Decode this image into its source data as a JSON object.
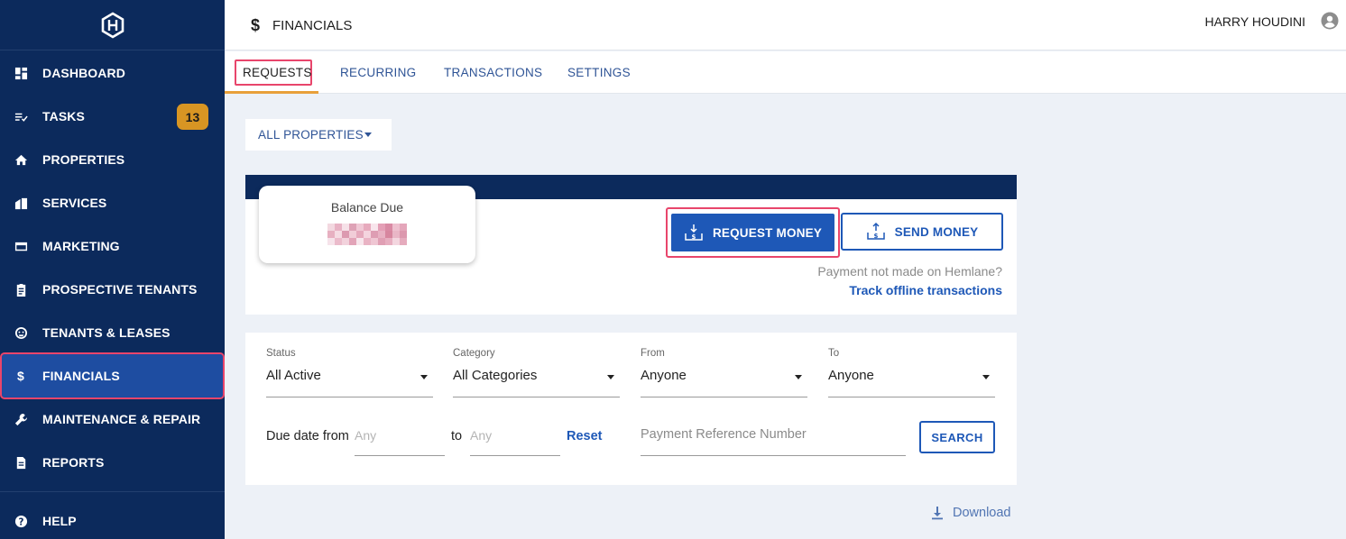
{
  "sidebar": {
    "items": [
      {
        "label": "DASHBOARD",
        "icon": "dashboard-icon"
      },
      {
        "label": "TASKS",
        "icon": "tasks-icon",
        "badge": "13"
      },
      {
        "label": "PROPERTIES",
        "icon": "home-icon"
      },
      {
        "label": "SERVICES",
        "icon": "services-icon"
      },
      {
        "label": "MARKETING",
        "icon": "marketing-icon"
      },
      {
        "label": "PROSPECTIVE TENANTS",
        "icon": "clipboard-icon"
      },
      {
        "label": "TENANTS & LEASES",
        "icon": "tenants-icon"
      },
      {
        "label": "FINANCIALS",
        "icon": "dollar-icon",
        "active": true
      },
      {
        "label": "MAINTENANCE & REPAIR",
        "icon": "wrench-icon"
      },
      {
        "label": "REPORTS",
        "icon": "document-icon"
      },
      {
        "label": "HELP",
        "icon": "help-icon"
      }
    ]
  },
  "header": {
    "section_icon": "$",
    "title": "FINANCIALS",
    "user_name": "HARRY HOUDINI"
  },
  "tabs": [
    {
      "label": "REQUESTS",
      "active": true
    },
    {
      "label": "RECURRING"
    },
    {
      "label": "TRANSACTIONS"
    },
    {
      "label": "SETTINGS"
    }
  ],
  "property_filter": {
    "selected": "ALL PROPERTIES"
  },
  "balance": {
    "label": "Balance Due",
    "request_button": "REQUEST MONEY",
    "send_button": "SEND MONEY",
    "offline_question": "Payment not made on Hemlane?",
    "offline_link": "Track offline transactions"
  },
  "filters": {
    "status": {
      "label": "Status",
      "value": "All Active"
    },
    "category": {
      "label": "Category",
      "value": "All Categories"
    },
    "from": {
      "label": "From",
      "value": "Anyone"
    },
    "to": {
      "label": "To",
      "value": "Anyone"
    },
    "due_date_label": "Due date from",
    "due_from_placeholder": "Any",
    "to_label": "to",
    "due_to_placeholder": "Any",
    "reset": "Reset",
    "reference_placeholder": "Payment Reference Number",
    "search": "SEARCH"
  },
  "download": "Download",
  "colors": {
    "sidebar": "#0c2a5c",
    "accent": "#1e58b7",
    "highlight": "#e8456b",
    "badge": "#d89523"
  }
}
